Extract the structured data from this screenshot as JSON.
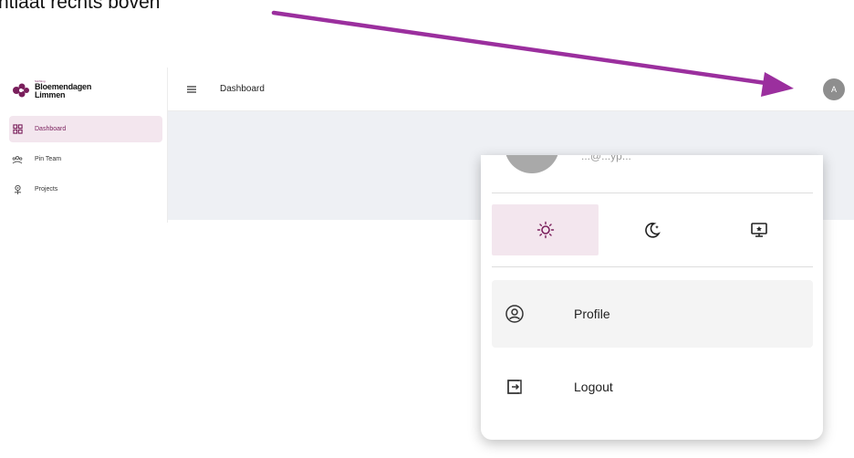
{
  "annotation": {
    "caption": "ntlaat rechts boven",
    "arrow_color": "#9b2f9e"
  },
  "sidebar": {
    "logo": {
      "small": "Stichting",
      "line1": "Bloemendagen",
      "line2": "Limmen"
    },
    "items": [
      {
        "label": "Dashboard",
        "icon": "dashboard-grid-icon",
        "active": true
      },
      {
        "label": "Pin Team",
        "icon": "team-icon",
        "active": false
      },
      {
        "label": "Projects",
        "icon": "flower-icon",
        "active": false
      }
    ]
  },
  "topbar": {
    "title": "Dashboard",
    "avatar_initial": "A"
  },
  "user_menu": {
    "user_text": "...@...yp...",
    "themes": [
      {
        "name": "light",
        "icon": "sun-icon",
        "active": true
      },
      {
        "name": "dark",
        "icon": "moon-icon",
        "active": false
      },
      {
        "name": "system",
        "icon": "monitor-icon",
        "active": false
      }
    ],
    "items": [
      {
        "label": "Profile",
        "icon": "profile-icon"
      },
      {
        "label": "Logout",
        "icon": "logout-icon"
      }
    ]
  },
  "colors": {
    "accent": "#7a1f5c",
    "accent_bg": "#f3e6ee",
    "content_bg": "#eef0f4"
  }
}
